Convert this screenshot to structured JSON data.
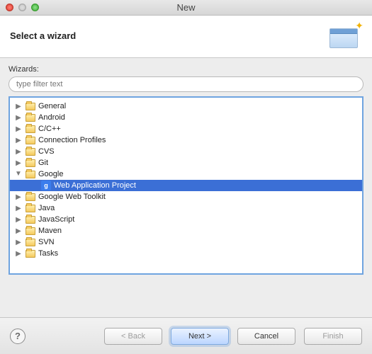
{
  "window": {
    "title": "New"
  },
  "header": {
    "title": "Select a wizard"
  },
  "wizards_label": "Wizards:",
  "filter": {
    "placeholder": "type filter text",
    "value": ""
  },
  "tree": {
    "items": [
      {
        "label": "General",
        "expanded": false
      },
      {
        "label": "Android",
        "expanded": false
      },
      {
        "label": "C/C++",
        "expanded": false
      },
      {
        "label": "Connection Profiles",
        "expanded": false
      },
      {
        "label": "CVS",
        "expanded": false
      },
      {
        "label": "Git",
        "expanded": false
      },
      {
        "label": "Google",
        "expanded": true,
        "children": [
          {
            "label": "Web Application Project",
            "selected": true,
            "icon": "google"
          }
        ]
      },
      {
        "label": "Google Web Toolkit",
        "expanded": false
      },
      {
        "label": "Java",
        "expanded": false
      },
      {
        "label": "JavaScript",
        "expanded": false
      },
      {
        "label": "Maven",
        "expanded": false
      },
      {
        "label": "SVN",
        "expanded": false
      },
      {
        "label": "Tasks",
        "expanded": false
      }
    ]
  },
  "buttons": {
    "back": "< Back",
    "next": "Next >",
    "cancel": "Cancel",
    "finish": "Finish"
  }
}
